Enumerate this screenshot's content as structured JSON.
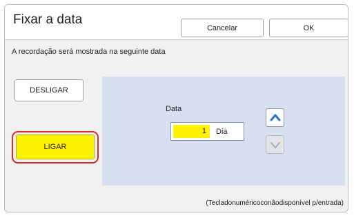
{
  "dialog": {
    "title": "Fixar a data",
    "cancel_label": "Cancelar",
    "ok_label": "OK",
    "subtitle": "A recordação será mostrada na seguinte data"
  },
  "toggle": {
    "off_label": "DESLIGAR",
    "on_label": "LIGAR",
    "selected": "LIGAR"
  },
  "date_panel": {
    "label": "Data",
    "value": "1",
    "unit": "Dia"
  },
  "footer": {
    "note": "(Tecladonuméricoconãodisponível p/entrada)"
  },
  "icons": {
    "up": "chevron-up-icon",
    "down": "chevron-down-icon"
  },
  "colors": {
    "selected_fill": "#fff200",
    "selected_ring": "#d62b2b",
    "panel_bg": "#d8dff0",
    "arrow_blue": "#2a6fd0"
  }
}
